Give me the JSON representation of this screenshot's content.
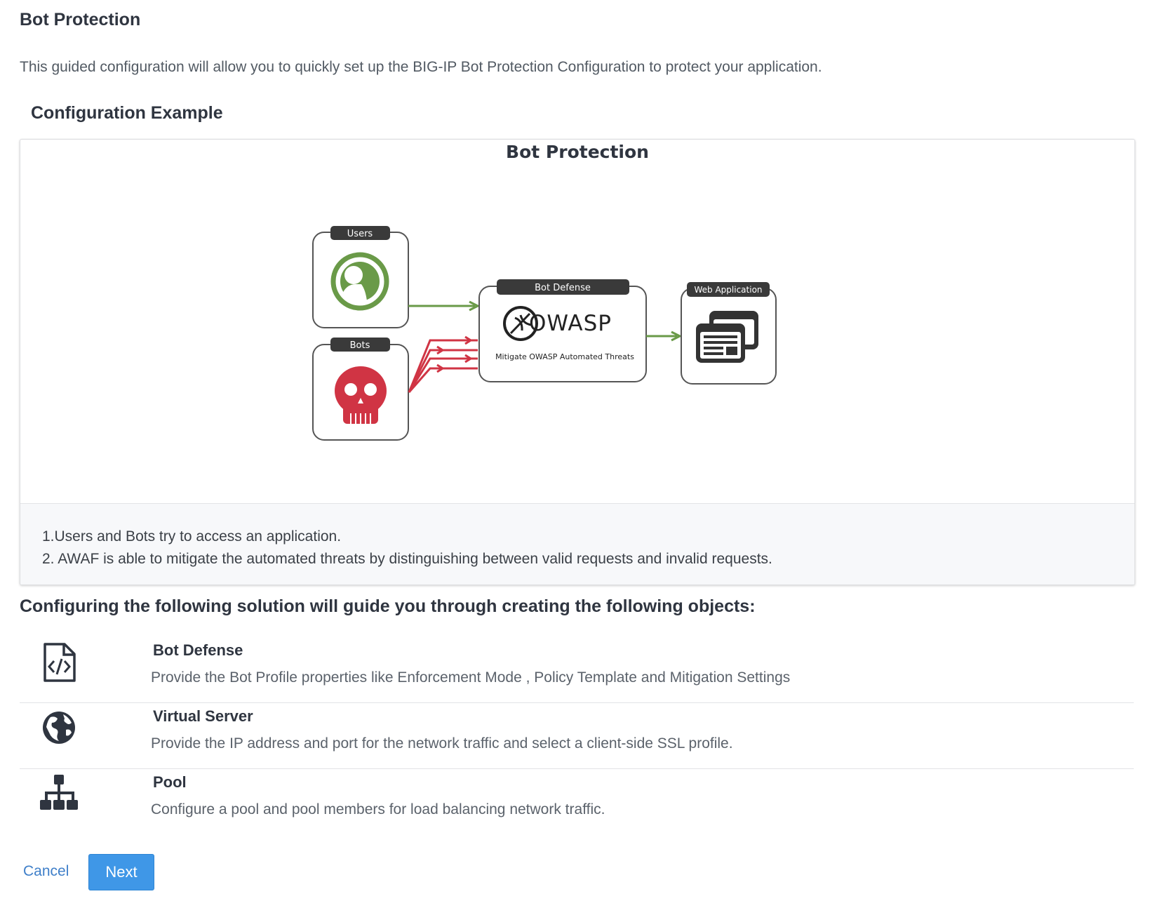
{
  "page": {
    "title": "Bot Protection",
    "intro": "This guided configuration will allow you to quickly set up the BIG-IP Bot Protection Configuration to protect your application.",
    "config_heading": "Configuration Example"
  },
  "diagram": {
    "title": "Bot Protection",
    "users_label": "Users",
    "bots_label": "Bots",
    "bot_defense_label": "Bot Defense",
    "owasp_logo_text": "OWASP",
    "owasp_caption": "Mitigate OWASP Automated Threats",
    "web_app_label": "Web Application",
    "colors": {
      "user": "#6a9a48",
      "bot": "#d03444",
      "dark": "#3a3a3a"
    }
  },
  "steps": [
    "1.Users and Bots try to access an application.",
    "2. AWAF is able to mitigate the automated threats by distinguishing between valid requests and invalid requests."
  ],
  "objects": {
    "heading": "Configuring the following solution will guide you through creating the following objects:",
    "items": [
      {
        "icon": "code-file-icon",
        "title": "Bot Defense",
        "description": "Provide the Bot Profile properties like Enforcement Mode , Policy Template and Mitigation Settings"
      },
      {
        "icon": "globe-icon",
        "title": "Virtual Server",
        "description": "Provide the IP address and port for the network traffic and select a client-side SSL profile."
      },
      {
        "icon": "sitemap-icon",
        "title": "Pool",
        "description": "Configure a pool and pool members for load balancing network traffic."
      }
    ]
  },
  "actions": {
    "cancel_label": "Cancel",
    "next_label": "Next"
  }
}
